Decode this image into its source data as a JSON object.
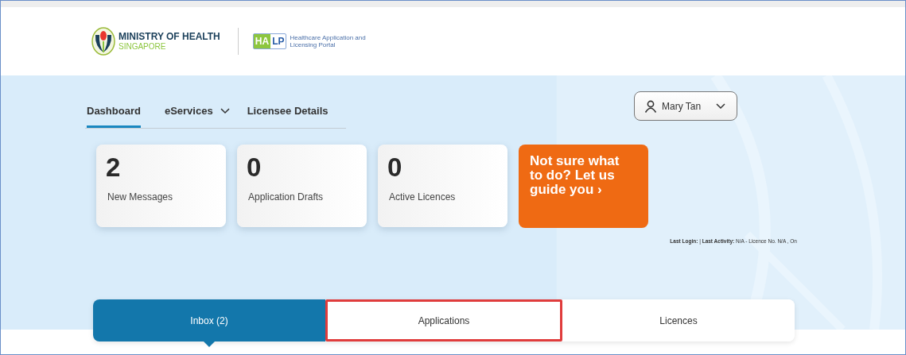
{
  "header": {
    "ministry_name": "MINISTRY OF HEALTH",
    "ministry_country": "SINGAPORE",
    "portal_logo": [
      "HA",
      "LP"
    ],
    "portal_name": "Healthcare Application and Licensing Portal"
  },
  "nav": [
    {
      "label": "Dashboard",
      "selected": true,
      "dropdown": false
    },
    {
      "label": "eServices",
      "selected": false,
      "dropdown": true
    },
    {
      "label": "Licensee Details",
      "selected": false,
      "dropdown": false
    }
  ],
  "user_menu": {
    "name": "Mary Tan"
  },
  "stats": [
    {
      "count": "2",
      "label": "New Messages"
    },
    {
      "count": "0",
      "label": "Application Drafts"
    },
    {
      "count": "0",
      "label": "Active Licences"
    }
  ],
  "guide_card": {
    "text": "Not sure what to do? Let us guide you",
    "arrow": "›"
  },
  "last_login": "**Last Login:** | **Last Activity:** N/A - Licence No. N/A , On",
  "tabs": [
    {
      "label": "Inbox (2)",
      "selected": true,
      "highlighted": false
    },
    {
      "label": "Applications",
      "selected": false,
      "highlighted": true
    },
    {
      "label": "Licences",
      "selected": false,
      "highlighted": false
    }
  ]
}
